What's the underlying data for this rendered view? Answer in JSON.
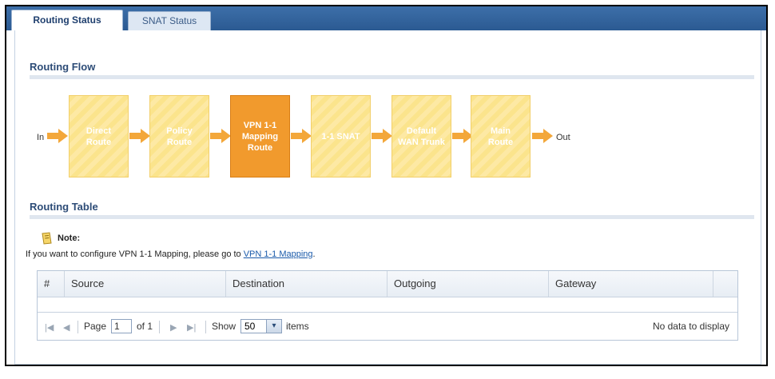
{
  "tabs": [
    {
      "label": "Routing Status",
      "active": true
    },
    {
      "label": "SNAT Status",
      "active": false
    }
  ],
  "routing_flow": {
    "title": "Routing Flow",
    "in_label": "In",
    "out_label": "Out",
    "steps": [
      {
        "label": "Direct\nRoute",
        "active": false
      },
      {
        "label": "Policy\nRoute",
        "active": false
      },
      {
        "label": "VPN 1-1\nMapping\nRoute",
        "active": true
      },
      {
        "label": "1-1 SNAT",
        "active": false
      },
      {
        "label": "Default\nWAN Trunk",
        "active": false
      },
      {
        "label": "Main\nRoute",
        "active": false
      }
    ]
  },
  "routing_table": {
    "title": "Routing Table",
    "note_title": "Note:",
    "note_text": "If you want to configure VPN 1-1 Mapping, please go to ",
    "note_link": "VPN 1-1 Mapping",
    "note_end": ".",
    "columns": [
      "#",
      "Source",
      "Destination",
      "Outgoing",
      "Gateway"
    ],
    "rows": [],
    "pager": {
      "page_label": "Page",
      "page_value": "1",
      "of_label": "of 1",
      "show_label": "Show",
      "show_value": "50",
      "items_label": "items",
      "empty_text": "No data to display"
    }
  },
  "colors": {
    "active_step": "#f19a2d",
    "inactive_step": "#fbe48c",
    "arrow": "#f3a73a",
    "header_blue": "#2b5a92"
  }
}
